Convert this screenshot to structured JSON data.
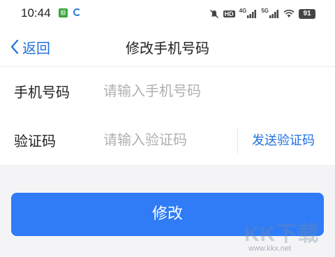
{
  "status_bar": {
    "time": "10:44",
    "app_badge": "顺",
    "battery": "91",
    "network_1": "4G",
    "network_2": "5G",
    "hd": "HD"
  },
  "nav": {
    "back_label": "返回",
    "title": "修改手机号码"
  },
  "form": {
    "phone_label": "手机号码",
    "phone_placeholder": "请输入手机号码",
    "phone_value": "",
    "code_label": "验证码",
    "code_placeholder": "请输入验证码",
    "code_value": "",
    "send_code_label": "发送验证码"
  },
  "submit_label": "修改",
  "watermark": {
    "text": "KK下载",
    "url": "www.kkx.net"
  },
  "colors": {
    "accent": "#2f7cf6",
    "link": "#1f6fe0"
  }
}
